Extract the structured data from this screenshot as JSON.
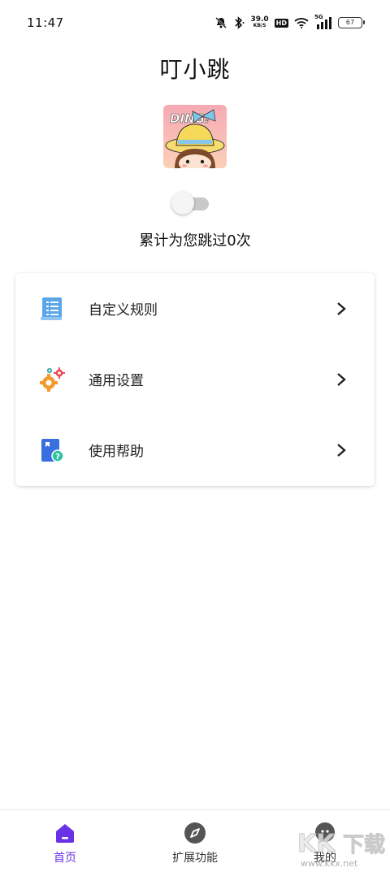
{
  "status_bar": {
    "time": "11:47",
    "net_speed_value": "39.0",
    "net_speed_unit": "KB/S",
    "hd_label": "HD",
    "network_label": "5G",
    "battery_level": "67"
  },
  "app": {
    "title": "叮小跳",
    "logo_text": "DING!",
    "service_enabled": false,
    "skip_count_text": "累计为您跳过0次"
  },
  "menu": {
    "items": [
      {
        "label": "自定义规则",
        "icon": "document-list-icon"
      },
      {
        "label": "通用设置",
        "icon": "gears-icon"
      },
      {
        "label": "使用帮助",
        "icon": "help-book-icon"
      }
    ]
  },
  "bottom_nav": {
    "items": [
      {
        "label": "首页",
        "icon": "home-icon",
        "active": true
      },
      {
        "label": "扩展功能",
        "icon": "compass-icon",
        "active": false
      },
      {
        "label": "我的",
        "icon": "chat-profile-icon",
        "active": false
      }
    ]
  },
  "watermark": {
    "brand": "KK下载",
    "url": "www.kkx.net"
  },
  "colors": {
    "accent": "#6a32e6",
    "toggle_off": "#c9c9c9",
    "text": "#222222"
  }
}
